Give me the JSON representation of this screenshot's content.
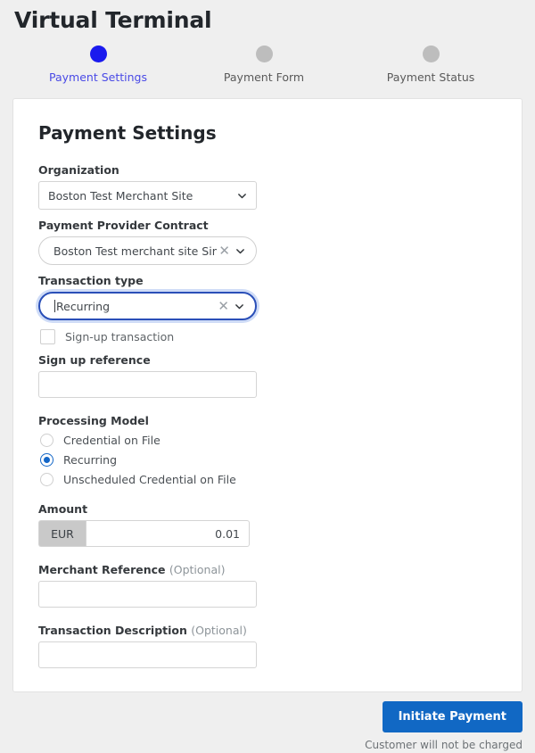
{
  "page": {
    "title": "Virtual Terminal"
  },
  "stepper": {
    "steps": [
      {
        "label": "Payment Settings",
        "state": "active"
      },
      {
        "label": "Payment Form",
        "state": "inactive"
      },
      {
        "label": "Payment Status",
        "state": "inactive"
      }
    ]
  },
  "card": {
    "title": "Payment Settings",
    "organization": {
      "label": "Organization",
      "value": "Boston Test Merchant Site",
      "caret_icon": "chevron-down-icon"
    },
    "provider_contract": {
      "label": "Payment Provider Contract",
      "value": "Boston Test merchant site Sim ...",
      "clear_icon": "close-x-icon",
      "caret_icon": "chevron-down-icon"
    },
    "transaction_type": {
      "label": "Transaction type",
      "value": "Recurring",
      "focused": true,
      "clear_icon": "close-x-icon",
      "caret_icon": "chevron-down-icon"
    },
    "signup_transaction": {
      "label": "Sign-up transaction",
      "checked": false
    },
    "signup_reference": {
      "label": "Sign up reference",
      "value": "",
      "placeholder": ""
    },
    "processing_model": {
      "label": "Processing Model",
      "options": [
        {
          "label": "Credential on File",
          "selected": false
        },
        {
          "label": "Recurring",
          "selected": true
        },
        {
          "label": "Unscheduled Credential on File",
          "selected": false
        }
      ]
    },
    "amount": {
      "label": "Amount",
      "currency": "EUR",
      "value": "0.01"
    },
    "merchant_reference": {
      "label": "Merchant Reference",
      "optional_suffix": "(Optional)",
      "value": "",
      "placeholder": ""
    },
    "transaction_description": {
      "label": "Transaction Description",
      "optional_suffix": "(Optional)",
      "value": "",
      "placeholder": ""
    }
  },
  "footer": {
    "submit_label": "Initiate Payment",
    "note": "Customer will not be charged"
  },
  "colors": {
    "page_bg": "#efefef",
    "active_step": "#1a1aee",
    "active_step_label": "#4a4ae6",
    "inactive_step": "#bdbdbd",
    "primary_button": "#1168c4",
    "radio_selected": "#1366c7",
    "focus_border": "#2a4fb8",
    "amount_prefix_bg": "#c9c9c9"
  }
}
